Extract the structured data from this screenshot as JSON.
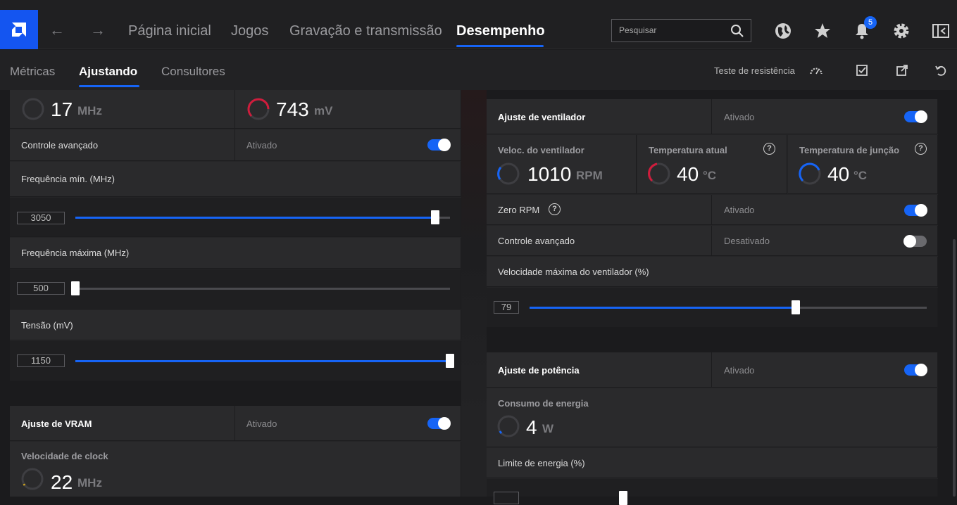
{
  "nav": {
    "items": [
      "Página inicial",
      "Jogos",
      "Gravação e transmissão",
      "Desempenho"
    ],
    "active": "Desempenho"
  },
  "search": {
    "placeholder": "Pesquisar"
  },
  "notifications": {
    "count": "5"
  },
  "subnav": {
    "items": [
      "Métricas",
      "Ajustando",
      "Consultores"
    ],
    "active": "Ajustando",
    "stress_test": "Teste de resistência"
  },
  "gpu_tuning": {
    "clock_value": "17",
    "clock_unit": "MHz",
    "voltage_value": "743",
    "voltage_unit": "mV",
    "advanced_control": {
      "label": "Controle avançado",
      "state": "Ativado",
      "on": true
    },
    "min_freq": {
      "label": "Frequência mín. (MHz)",
      "value": "3050",
      "fraction": 0.96
    },
    "max_freq": {
      "label": "Frequência máxima (MHz)",
      "value": "500",
      "fraction": 0.0
    },
    "voltage": {
      "label": "Tensão (mV)",
      "value": "1150",
      "fraction": 1.0
    }
  },
  "vram_tuning": {
    "title": "Ajuste de VRAM",
    "state": "Ativado",
    "on": true,
    "clock_label": "Velocidade de clock",
    "clock_value": "22",
    "clock_unit": "MHz"
  },
  "fan_tuning": {
    "title": "Ajuste de ventilador",
    "state": "Ativado",
    "on": true,
    "fan_speed": {
      "label": "Veloc. do ventilador",
      "value": "1010",
      "unit": "RPM"
    },
    "current_temp": {
      "label": "Temperatura atual",
      "value": "40",
      "unit": "°C"
    },
    "junction_temp": {
      "label": "Temperatura de junção",
      "value": "40",
      "unit": "°C"
    },
    "zero_rpm": {
      "label": "Zero RPM",
      "state": "Ativado",
      "on": true
    },
    "advanced_control": {
      "label": "Controle avançado",
      "state": "Desativado",
      "on": false
    },
    "max_speed": {
      "label": "Velocidade máxima do ventilador (%)",
      "value": "79",
      "fraction": 0.67
    }
  },
  "power_tuning": {
    "title": "Ajuste de potência",
    "state": "Ativado",
    "on": true,
    "consumption_label": "Consumo de energia",
    "consumption_value": "4",
    "consumption_unit": "W",
    "power_limit_label": "Limite de energia (%)"
  },
  "colors": {
    "accent": "#1664f6",
    "logo": "#1455f0",
    "gauge_red": "#d01c3c",
    "gauge_blue": "#1664f6"
  }
}
